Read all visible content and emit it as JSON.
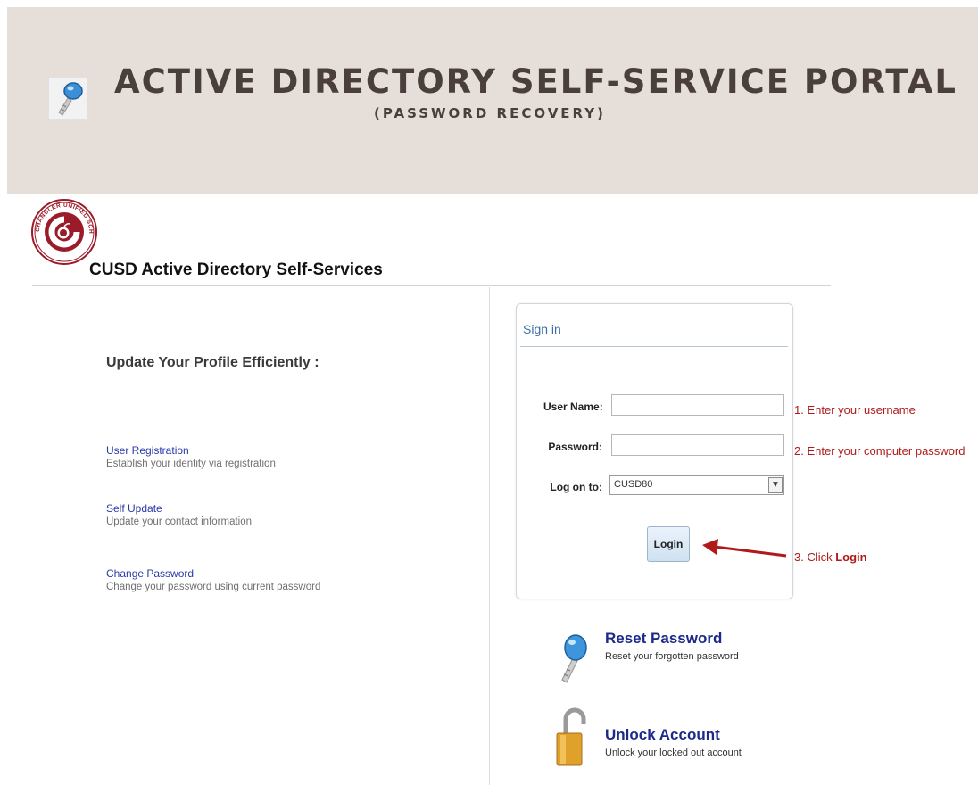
{
  "banner": {
    "title": "ACTIVE DIRECTORY SELF-SERVICE PORTAL",
    "subtitle": "(PASSWORD RECOVERY)"
  },
  "portal": {
    "title": "CUSD Active Directory Self-Services",
    "seal_text": "CHANDLER UNIFIED SCHOOL DISTRICT"
  },
  "left_panel": {
    "heading": "Update Your Profile Efficiently :",
    "features": [
      {
        "label": "User Registration",
        "description": "Establish your identity via registration"
      },
      {
        "label": "Self Update",
        "description": "Update your contact information"
      },
      {
        "label": "Change Password",
        "description": "Change your password using current password"
      }
    ]
  },
  "signin": {
    "title": "Sign in",
    "username_label": "User Name:",
    "username_value": "",
    "password_label": "Password:",
    "password_value": "",
    "logon_label": "Log on to:",
    "logon_value": "CUSD80",
    "login_button": "Login"
  },
  "annotations": {
    "step1": "1. Enter your username",
    "step2": "2. Enter your computer password",
    "step3_prefix": "3. Click ",
    "step3_bold": "Login"
  },
  "actions": [
    {
      "title": "Reset Password",
      "description": "Reset your forgotten password",
      "icon": "key-icon"
    },
    {
      "title": "Unlock Account",
      "description": "Unlock your locked out account",
      "icon": "padlock-icon"
    }
  ],
  "colors": {
    "banner_bg": "#e6ded9",
    "link_blue": "#2b3aa8",
    "annotation_red": "#b01a1a",
    "seal_red": "#9b1b2a"
  }
}
